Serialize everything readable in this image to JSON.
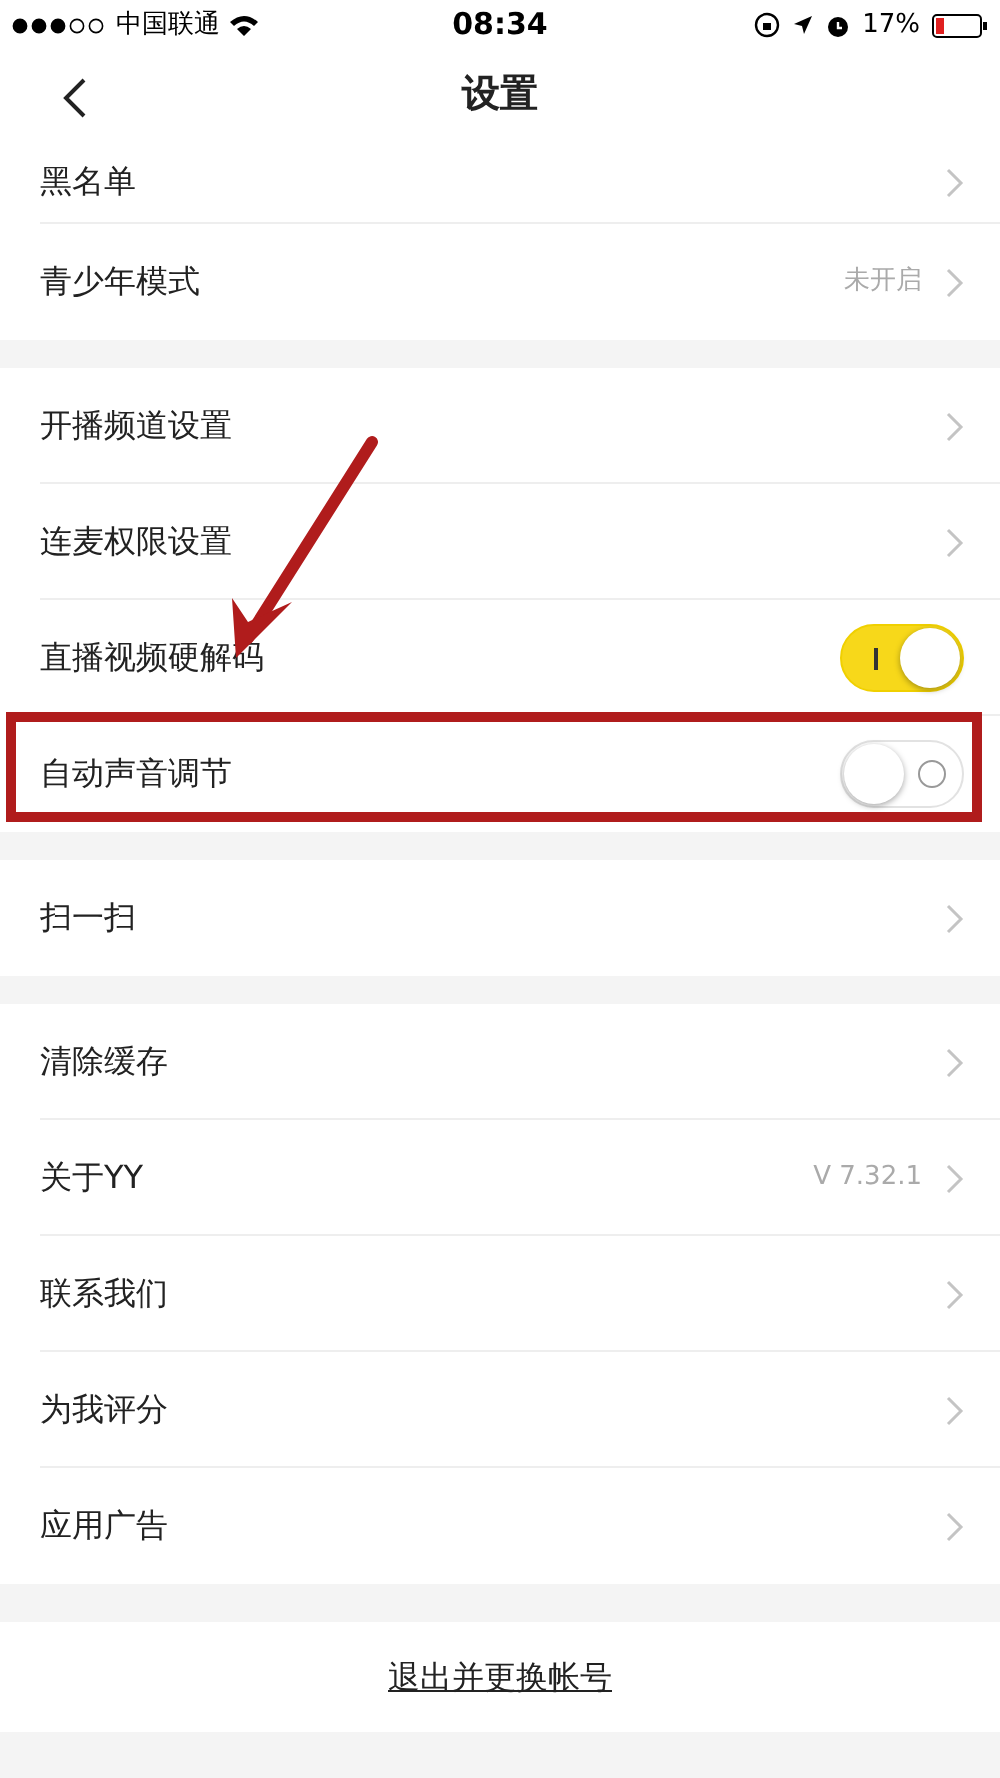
{
  "status_bar": {
    "carrier": "中国联通",
    "time": "08:34",
    "battery": "17%"
  },
  "nav": {
    "title": "设置"
  },
  "sections": [
    {
      "items": [
        {
          "kind": "link",
          "label": "黑名单"
        },
        {
          "kind": "link",
          "label": "青少年模式",
          "value": "未开启"
        }
      ]
    },
    {
      "items": [
        {
          "kind": "link",
          "label": "开播频道设置"
        },
        {
          "kind": "link",
          "label": "连麦权限设置"
        },
        {
          "kind": "toggle",
          "label": "直播视频硬解码",
          "on": true
        },
        {
          "kind": "toggle",
          "label": "自动声音调节",
          "on": false
        }
      ]
    },
    {
      "items": [
        {
          "kind": "link",
          "label": "扫一扫"
        }
      ]
    },
    {
      "items": [
        {
          "kind": "link",
          "label": "清除缓存"
        },
        {
          "kind": "link",
          "label": "关于YY",
          "value": "V 7.32.1"
        },
        {
          "kind": "link",
          "label": "联系我们"
        },
        {
          "kind": "link",
          "label": "为我评分"
        },
        {
          "kind": "link",
          "label": "应用广告"
        }
      ]
    }
  ],
  "logout_button": "退出并更换帐号"
}
